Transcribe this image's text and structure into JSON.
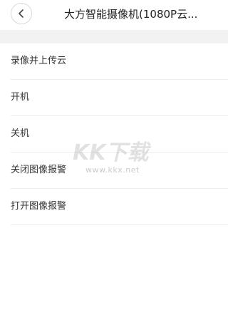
{
  "header": {
    "title": "大方智能摄像机(1080P云..."
  },
  "menu": {
    "items": [
      {
        "label": "录像并上传云"
      },
      {
        "label": "开机"
      },
      {
        "label": "关机"
      },
      {
        "label": "关闭图像报警"
      },
      {
        "label": "打开图像报警"
      }
    ]
  },
  "watermark": {
    "logo": "KK下载",
    "url": "www.kkx.net"
  },
  "icons": {
    "back": "chevron-left-icon"
  },
  "colors": {
    "band": "#f2f2f2",
    "divider": "#ececec",
    "text": "#333333"
  }
}
